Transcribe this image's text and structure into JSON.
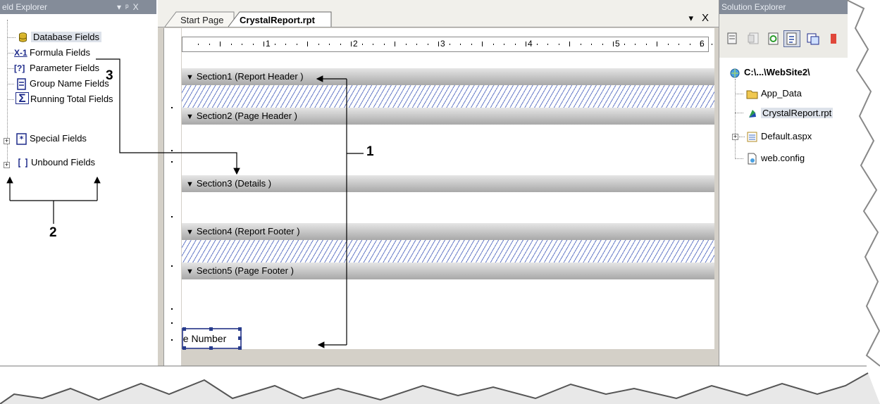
{
  "field_explorer": {
    "title": "eld Explorer",
    "controls": "▾ p X",
    "items": [
      {
        "label": "Database Fields",
        "icon": "database-icon"
      },
      {
        "label": "Formula Fields",
        "icon": "formula-icon",
        "icon_text": "X-1"
      },
      {
        "label": "Parameter Fields",
        "icon": "parameter-icon",
        "icon_text": "[?]"
      },
      {
        "label": "Group Name Fields",
        "icon": "group-name-icon"
      },
      {
        "label": "Running Total Fields",
        "icon": "running-total-icon",
        "icon_text": "Σ"
      },
      {
        "label": "Special Fields",
        "icon": "special-fields-icon"
      },
      {
        "label": "Unbound Fields",
        "icon": "unbound-fields-icon"
      }
    ]
  },
  "document": {
    "tabs": [
      {
        "label": "Start Page",
        "active": false
      },
      {
        "label": "CrystalReport.rpt",
        "active": true
      }
    ],
    "dropdown": "▾",
    "close": "X",
    "ruler_numbers": [
      "1",
      "2",
      "3",
      "4",
      "5",
      "6"
    ],
    "sections": [
      {
        "label": "Section1 (Report Header )",
        "suppressed": true
      },
      {
        "label": "Section2 (Page Header )",
        "suppressed": false
      },
      {
        "label": "Section3 (Details )",
        "suppressed": false
      },
      {
        "label": "Section4 (Report Footer )",
        "suppressed": true
      },
      {
        "label": "Section5 (Page Footer )",
        "suppressed": false
      }
    ],
    "page_number_field": "ge Number"
  },
  "solution_explorer": {
    "title": "Solution Explorer",
    "root": "C:\\...\\WebSite2\\",
    "items": [
      {
        "label": "App_Data",
        "icon": "folder-icon",
        "expandable": false
      },
      {
        "label": "CrystalReport.rpt",
        "icon": "crystal-report-icon",
        "expandable": false,
        "selected": true
      },
      {
        "label": "Default.aspx",
        "icon": "aspx-page-icon",
        "expandable": true
      },
      {
        "label": "web.config",
        "icon": "config-file-icon",
        "expandable": false
      }
    ]
  },
  "annotations": {
    "label1": "1",
    "label2": "2",
    "label3": "3"
  },
  "colors": {
    "panel_title": "#848c99",
    "hatch": "#6a7ec8",
    "selection_border": "#4e5a9e"
  }
}
